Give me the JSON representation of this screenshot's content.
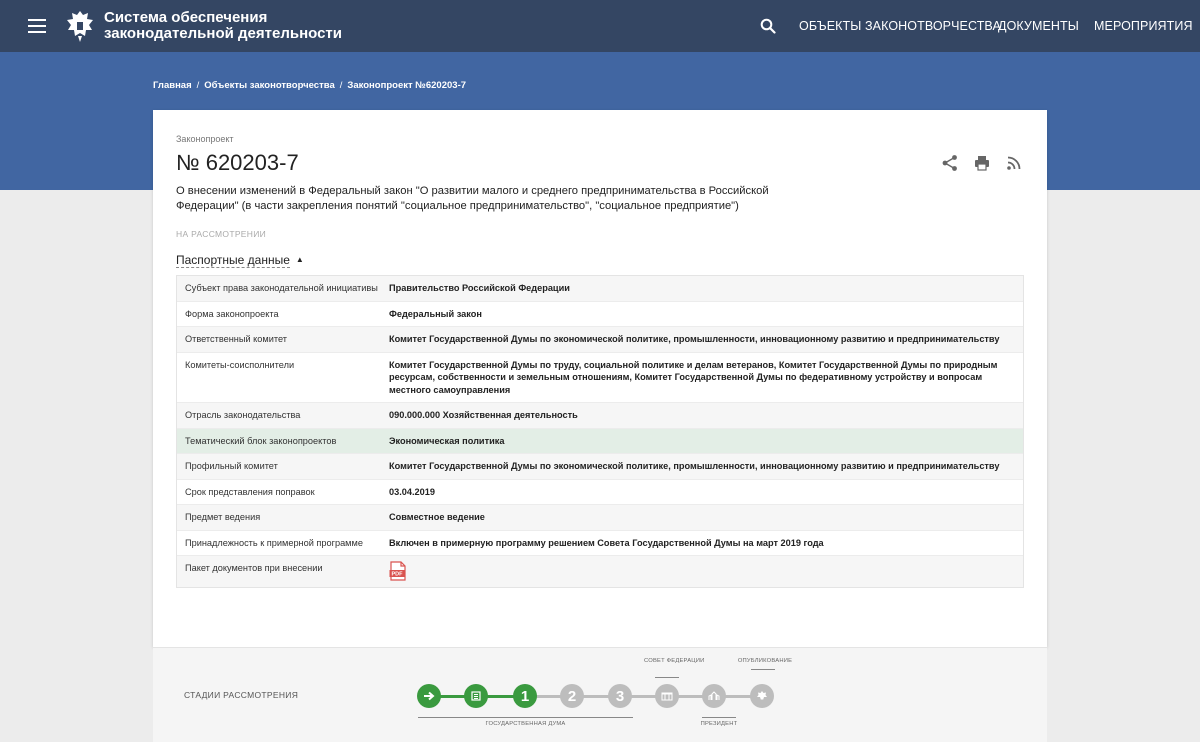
{
  "header": {
    "site_title": "Система обеспечения законодательной деятельности",
    "nav": [
      "ОБЪЕКТЫ ЗАКОНОТВОРЧЕСТВА",
      "ДОКУМЕНТЫ",
      "МЕРОПРИЯТИЯ"
    ],
    "icons": {
      "menu": "hamburger-icon",
      "emblem": "emblem-icon",
      "search": "search-icon"
    },
    "color": "#344663"
  },
  "breadcrumb": [
    "Главная",
    "Объекты законотворчества",
    "Законопроект №620203-7"
  ],
  "bill": {
    "kind": "Законопроект",
    "number": "№ 620203-7",
    "title": "О внесении изменений в Федеральный закон \"О развитии малого и среднего предпринимательства в Российской Федерации\" (в части закрепления понятий \"социальное предпринимательство\", \"социальное предприятие\")",
    "status": "НА РАССМОТРЕНИИ",
    "actions": [
      "share-icon",
      "print-icon",
      "rss-icon"
    ]
  },
  "passport": {
    "toggle_label": "Паспортные данные",
    "rows": [
      {
        "key": "Субъект права законодательной инициативы",
        "value": "Правительство Российской Федерации"
      },
      {
        "key": "Форма законопроекта",
        "value": "Федеральный закон"
      },
      {
        "key": "Ответственный комитет",
        "value": "Комитет Государственной Думы по экономической политике, промышленности, инновационному развитию и предпринимательству"
      },
      {
        "key": "Комитеты-соисполнители",
        "value": "Комитет Государственной Думы по труду, социальной политике и делам ветеранов, Комитет Государственной Думы по природным ресурсам, собственности и земельным отношениям, Комитет Государственной Думы по федеративному устройству и вопросам местного самоуправления"
      },
      {
        "key": "Отрасль законодательства",
        "value": "090.000.000 Хозяйственная деятельность"
      },
      {
        "key": "Тематический блок законопроектов",
        "value": "Экономическая политика"
      },
      {
        "key": "Профильный комитет",
        "value": "Комитет Государственной Думы по экономической политике, промышленности, инновационному развитию и предпринимательству"
      },
      {
        "key": "Срок представления поправок",
        "value": "03.04.2019"
      },
      {
        "key": "Предмет ведения",
        "value": "Совместное ведение"
      },
      {
        "key": "Принадлежность к примерной программе",
        "value": "Включен в примерную программу решением Совета Государственной Думы на март 2019 года"
      },
      {
        "key": "Пакет документов при внесении",
        "value": ""
      }
    ],
    "pdf_icon": "pdf-icon"
  },
  "stages": {
    "label": "СТАДИИ РАССМОТРЕНИЯ",
    "numbers": [
      "1",
      "2",
      "3"
    ],
    "captions": {
      "federation_council": "СОВЕТ ФЕДЕРАЦИИ",
      "publication": "ОПУБЛИКОВАНИЕ",
      "duma": "ГОСУДАРСТВЕННАЯ ДУМА",
      "president": "ПРЕЗИДЕНТ"
    },
    "colors": {
      "done": "#3a9a3f",
      "pending": "#bdbdbd"
    }
  }
}
